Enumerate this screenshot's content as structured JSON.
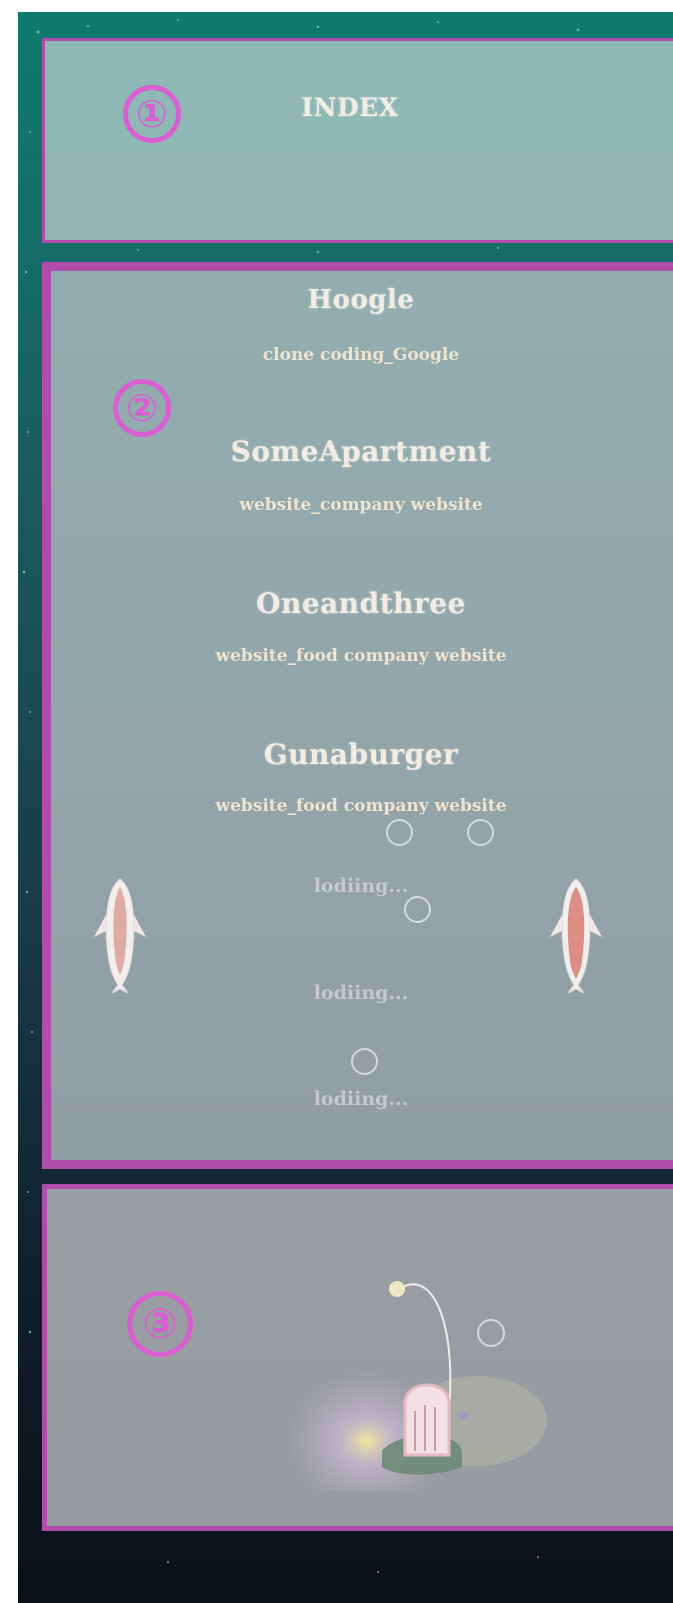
{
  "sections": {
    "index": {
      "badge": "①",
      "title": "INDEX"
    },
    "projects": {
      "badge": "②",
      "items": [
        {
          "name": "Hoogle",
          "desc": "clone coding_Google"
        },
        {
          "name": "SomeApartment",
          "desc": "website_company website"
        },
        {
          "name": "Oneandthree",
          "desc": "website_food company website"
        },
        {
          "name": "Gunaburger",
          "desc": "website_food company website"
        }
      ],
      "loading": [
        "lodiing...",
        "lodiing...",
        "lodiing..."
      ]
    },
    "footer": {
      "badge": "③"
    }
  },
  "colors": {
    "border": "#b04dab",
    "badge": "#d85ed2",
    "text": "#f1ece4"
  },
  "icons": [
    "koi-fish-icon",
    "anglerfish-icon",
    "bubble-icon"
  ]
}
